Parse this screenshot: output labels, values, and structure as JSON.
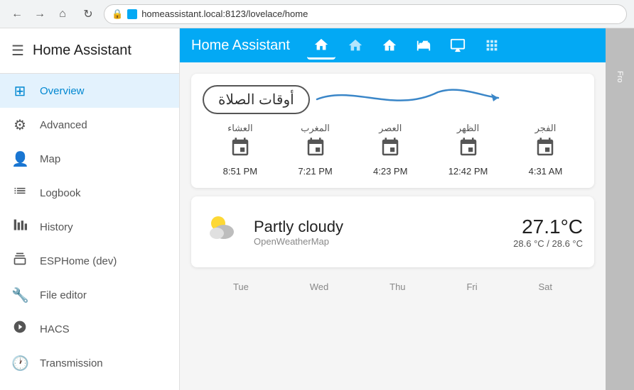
{
  "browser": {
    "back_label": "←",
    "forward_label": "→",
    "home_label": "⌂",
    "refresh_label": "↻",
    "url": "homeassistant.local:8123/lovelace/home",
    "lock_icon": "🔒"
  },
  "sidebar": {
    "title": "Home Assistant",
    "hamburger": "☰",
    "items": [
      {
        "id": "overview",
        "icon": "⊞",
        "label": "Overview",
        "active": true
      },
      {
        "id": "advanced",
        "icon": "⚙",
        "label": "Advanced",
        "active": false
      },
      {
        "id": "map",
        "icon": "👤",
        "label": "Map",
        "active": false
      },
      {
        "id": "logbook",
        "icon": "≡",
        "label": "Logbook",
        "active": false
      },
      {
        "id": "history",
        "icon": "📊",
        "label": "History",
        "active": false
      },
      {
        "id": "esphome",
        "icon": "🎞",
        "label": "ESPHome (dev)",
        "active": false
      },
      {
        "id": "file-editor",
        "icon": "🔧",
        "label": "File editor",
        "active": false
      },
      {
        "id": "hacs",
        "icon": "🎮",
        "label": "HACS",
        "active": false
      },
      {
        "id": "transmission",
        "icon": "🕐",
        "label": "Transmission",
        "active": false
      }
    ]
  },
  "topbar": {
    "title": "Home Assistant",
    "tabs": [
      {
        "id": "home",
        "icon": "🏠",
        "active": true
      },
      {
        "id": "building",
        "icon": "🏠",
        "active": false
      },
      {
        "id": "house2",
        "icon": "🏡",
        "active": false
      },
      {
        "id": "bath",
        "icon": "🛁",
        "active": false
      },
      {
        "id": "monitor",
        "icon": "🖥",
        "active": false
      },
      {
        "id": "network",
        "icon": "⊞",
        "active": false
      }
    ]
  },
  "prayer_card": {
    "title": "أوقات الصلاة",
    "times": [
      {
        "name": "العشاء",
        "time": "8:51 PM"
      },
      {
        "name": "المغرب",
        "time": "7:21 PM"
      },
      {
        "name": "العصر",
        "time": "4:23 PM"
      },
      {
        "name": "الظهر",
        "time": "12:42 PM"
      },
      {
        "name": "الفجر",
        "time": "4:31 AM"
      }
    ]
  },
  "weather_card": {
    "condition": "Partly cloudy",
    "source": "OpenWeatherMap",
    "temperature": "27.1°C",
    "temp_range": "28.6 °C / 28.6 °C",
    "days": [
      "Tue",
      "Wed",
      "Thu",
      "Fri",
      "Sat"
    ]
  },
  "right_panel": {
    "text1": "Fro"
  },
  "colors": {
    "primary": "#03a9f4",
    "active_bg": "#e3f2fd",
    "active_text": "#0288d1"
  }
}
